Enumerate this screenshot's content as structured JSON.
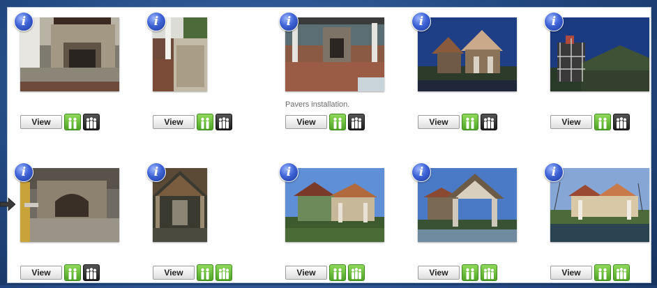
{
  "gallery": {
    "items": [
      {
        "caption": "",
        "view_label": "View",
        "tag1": "green",
        "tag2": "dark",
        "photo": "stone-fireplace-icon"
      },
      {
        "caption": "",
        "view_label": "View",
        "tag1": "green",
        "tag2": "dark",
        "photo": "brick-porch-wall-icon"
      },
      {
        "caption": "Pavers installation.",
        "view_label": "View",
        "tag1": "green",
        "tag2": "dark",
        "photo": "pavilion-pavers-icon"
      },
      {
        "caption": "",
        "view_label": "View",
        "tag1": "green",
        "tag2": "dark",
        "photo": "pavilion-framing-icon"
      },
      {
        "caption": "",
        "view_label": "View",
        "tag1": "green",
        "tag2": "dark",
        "photo": "roof-scaffold-icon"
      },
      {
        "caption": "",
        "view_label": "View",
        "tag1": "green",
        "tag2": "dark",
        "photo": "brick-oven-icon"
      },
      {
        "caption": "",
        "view_label": "View",
        "tag1": "green",
        "tag2": "green",
        "photo": "timber-roof-interior-icon"
      },
      {
        "caption": "",
        "view_label": "View",
        "tag1": "green",
        "tag2": "green",
        "photo": "pavilion-lawn-icon"
      },
      {
        "caption": "",
        "view_label": "View",
        "tag1": "green",
        "tag2": "green",
        "photo": "pavilion-gable-icon"
      },
      {
        "caption": "",
        "view_label": "View",
        "tag1": "green",
        "tag2": "green",
        "photo": "pavilion-pool-icon"
      }
    ]
  },
  "colors": {
    "tag_green": "#5cb82e",
    "tag_dark": "#2a2a2a",
    "info_blue": "#3f64d6"
  }
}
